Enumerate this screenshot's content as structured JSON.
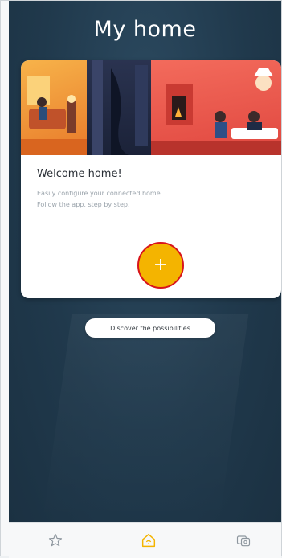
{
  "header": {
    "title": "My home"
  },
  "welcome_card": {
    "heading": "Welcome home!",
    "lines": [
      "Easily configure your connected home.",
      "Follow the app, step by step."
    ],
    "add_button_label": "+"
  },
  "discover_button": {
    "label": "Discover the possibilities"
  },
  "tabbar": {
    "items": [
      {
        "icon": "star-icon",
        "active": false
      },
      {
        "icon": "home-icon",
        "active": true
      },
      {
        "icon": "devices-icon",
        "active": false
      }
    ]
  },
  "colors": {
    "accent": "#f4b400",
    "background": "#20394c",
    "highlight_ring": "#d8141b"
  }
}
